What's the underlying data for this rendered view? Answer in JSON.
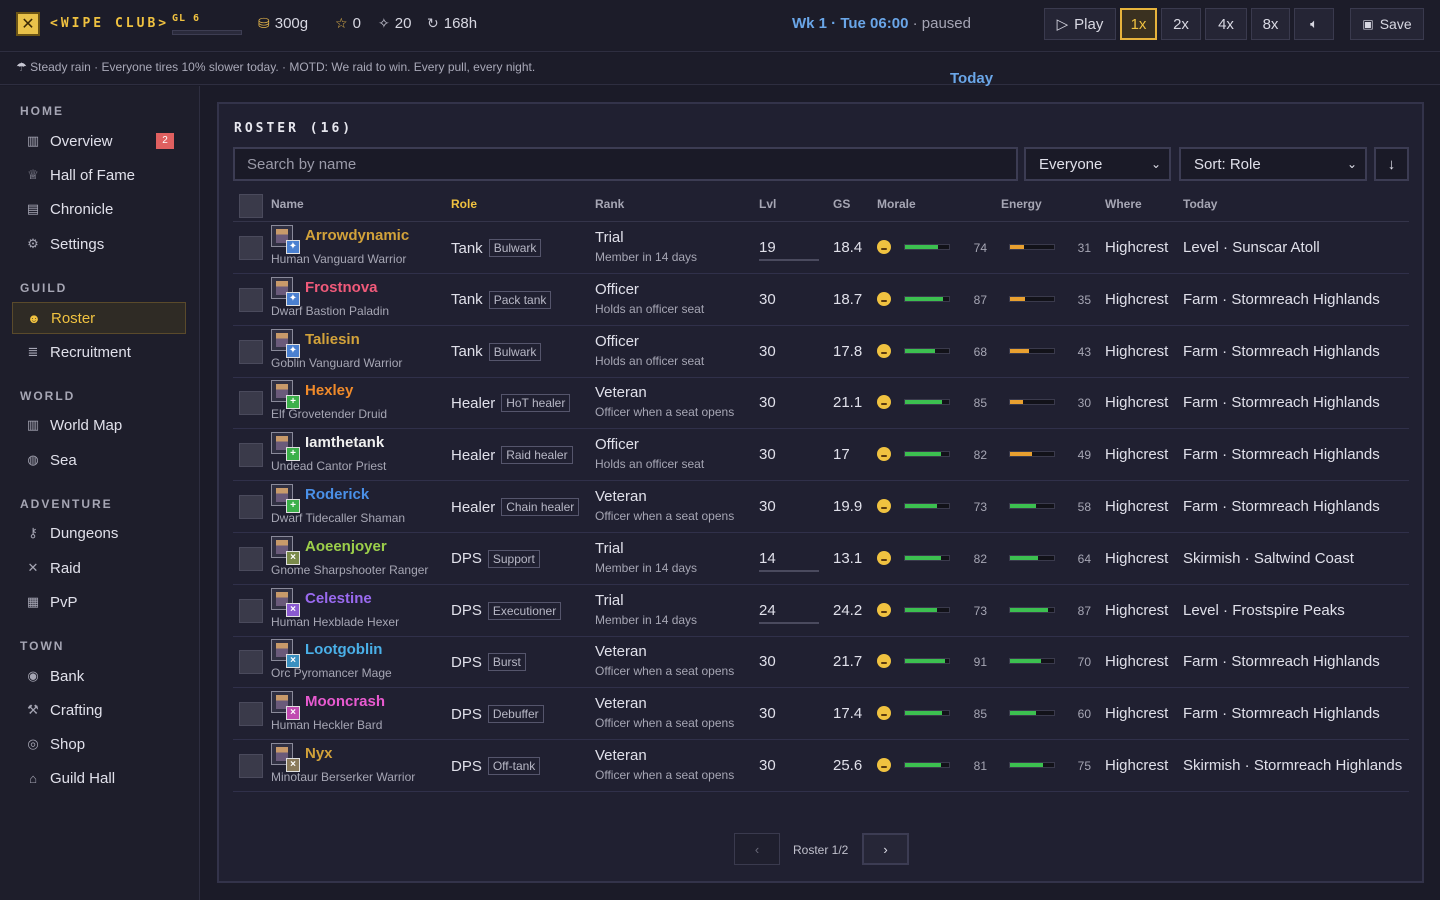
{
  "header": {
    "brand": "<WIPE CLUB>",
    "guild_level": "GL 6",
    "gold": "300g",
    "stars": "0",
    "sparks": "20",
    "hours": "168h",
    "week_day": "Wk 1 · Tue 06:00",
    "state": "· paused",
    "play_label": "Play",
    "speeds": [
      "1x",
      "2x",
      "4x",
      "8x"
    ],
    "active_speed": "1x",
    "save_label": "Save"
  },
  "motd": {
    "today_label": "Today",
    "text": "Steady rain · Everyone tires 10% slower today. · MOTD: We raid to win. Every pull, every night."
  },
  "sidebar": {
    "sections": [
      {
        "title": "HOME",
        "items": [
          {
            "label": "Overview",
            "icon": "overview-icon",
            "badge": "2"
          },
          {
            "label": "Hall of Fame",
            "icon": "trophy-icon"
          },
          {
            "label": "Chronicle",
            "icon": "book-icon"
          },
          {
            "label": "Settings",
            "icon": "gear-icon"
          }
        ]
      },
      {
        "title": "GUILD",
        "items": [
          {
            "label": "Roster",
            "icon": "people-icon",
            "active": true
          },
          {
            "label": "Recruitment",
            "icon": "scroll-icon"
          }
        ]
      },
      {
        "title": "WORLD",
        "items": [
          {
            "label": "World Map",
            "icon": "map-icon"
          },
          {
            "label": "Sea",
            "icon": "globe-icon"
          }
        ]
      },
      {
        "title": "ADVENTURE",
        "items": [
          {
            "label": "Dungeons",
            "icon": "key-icon"
          },
          {
            "label": "Raid",
            "icon": "swords-icon"
          },
          {
            "label": "PvP",
            "icon": "pvp-icon"
          }
        ]
      },
      {
        "title": "TOWN",
        "items": [
          {
            "label": "Bank",
            "icon": "bank-icon"
          },
          {
            "label": "Crafting",
            "icon": "hammer-icon"
          },
          {
            "label": "Shop",
            "icon": "bag-icon"
          },
          {
            "label": "Guild Hall",
            "icon": "house-icon"
          }
        ]
      }
    ]
  },
  "roster": {
    "title": "ROSTER (16)",
    "search_placeholder": "Search by name",
    "filter_value": "Everyone",
    "sort_value": "Sort: Role",
    "columns": [
      "Name",
      "Role",
      "Rank",
      "Lvl",
      "GS",
      "Morale",
      "Energy",
      "Where",
      "Today"
    ],
    "sorted_column": "Role",
    "rows": [
      {
        "name": "Arrowdynamic",
        "color": "#d2a23a",
        "desc": "Human Vanguard Warrior",
        "role": "Tank",
        "tag": "Bulwark",
        "rank": "Trial",
        "rank_sub": "Member in 14 days",
        "lvl": "19",
        "lvl_bar": true,
        "gs": "18.4",
        "morale": 74,
        "energy": 31,
        "where": "Highcrest",
        "today": "Level · Sunscar Atoll",
        "role_color": "#4a80d0",
        "role_glyph": "✦"
      },
      {
        "name": "Frostnova",
        "color": "#f05a7a",
        "desc": "Dwarf Bastion Paladin",
        "role": "Tank",
        "tag": "Pack tank",
        "rank": "Officer",
        "rank_sub": "Holds an officer seat",
        "lvl": "30",
        "lvl_bar": false,
        "gs": "18.7",
        "morale": 87,
        "energy": 35,
        "where": "Highcrest",
        "today": "Farm · Stormreach Highlands",
        "role_color": "#4a80d0",
        "role_glyph": "✦"
      },
      {
        "name": "Taliesin",
        "color": "#d2a23a",
        "desc": "Goblin Vanguard Warrior",
        "role": "Tank",
        "tag": "Bulwark",
        "rank": "Officer",
        "rank_sub": "Holds an officer seat",
        "lvl": "30",
        "lvl_bar": false,
        "gs": "17.8",
        "morale": 68,
        "energy": 43,
        "where": "Highcrest",
        "today": "Farm · Stormreach Highlands",
        "role_color": "#4a80d0",
        "role_glyph": "✦"
      },
      {
        "name": "Hexley",
        "color": "#f08a2a",
        "desc": "Elf Grovetender Druid",
        "role": "Healer",
        "tag": "HoT healer",
        "rank": "Veteran",
        "rank_sub": "Officer when a seat opens",
        "lvl": "30",
        "lvl_bar": false,
        "gs": "21.1",
        "morale": 85,
        "energy": 30,
        "where": "Highcrest",
        "today": "Farm · Stormreach Highlands",
        "role_color": "#3cb04a",
        "role_glyph": "+"
      },
      {
        "name": "Iamthetank",
        "color": "#f0f0f0",
        "desc": "Undead Cantor Priest",
        "role": "Healer",
        "tag": "Raid healer",
        "rank": "Officer",
        "rank_sub": "Holds an officer seat",
        "lvl": "30",
        "lvl_bar": false,
        "gs": "17",
        "morale": 82,
        "energy": 49,
        "where": "Highcrest",
        "today": "Farm · Stormreach Highlands",
        "role_color": "#3cb04a",
        "role_glyph": "+"
      },
      {
        "name": "Roderick",
        "color": "#4a90e8",
        "desc": "Dwarf Tidecaller Shaman",
        "role": "Healer",
        "tag": "Chain healer",
        "rank": "Veteran",
        "rank_sub": "Officer when a seat opens",
        "lvl": "30",
        "lvl_bar": false,
        "gs": "19.9",
        "morale": 73,
        "energy": 58,
        "where": "Highcrest",
        "today": "Farm · Stormreach Highlands",
        "role_color": "#3cb04a",
        "role_glyph": "+"
      },
      {
        "name": "Aoeenjoyer",
        "color": "#9ccf4a",
        "desc": "Gnome Sharpshooter Ranger",
        "role": "DPS",
        "tag": "Support",
        "rank": "Trial",
        "rank_sub": "Member in 14 days",
        "lvl": "14",
        "lvl_bar": true,
        "gs": "13.1",
        "morale": 82,
        "energy": 64,
        "where": "Highcrest",
        "today": "Skirmish · Saltwind Coast",
        "role_color": "#7a8a4a",
        "role_glyph": "×"
      },
      {
        "name": "Celestine",
        "color": "#9a6af0",
        "desc": "Human Hexblade Hexer",
        "role": "DPS",
        "tag": "Executioner",
        "rank": "Trial",
        "rank_sub": "Member in 14 days",
        "lvl": "24",
        "lvl_bar": true,
        "gs": "24.2",
        "morale": 73,
        "energy": 87,
        "where": "Highcrest",
        "today": "Level · Frostspire Peaks",
        "role_color": "#8a5ad0",
        "role_glyph": "×"
      },
      {
        "name": "Lootgoblin",
        "color": "#4ab0e8",
        "desc": "Orc Pyromancer Mage",
        "role": "DPS",
        "tag": "Burst",
        "rank": "Veteran",
        "rank_sub": "Officer when a seat opens",
        "lvl": "30",
        "lvl_bar": false,
        "gs": "21.7",
        "morale": 91,
        "energy": 70,
        "where": "Highcrest",
        "today": "Farm · Stormreach Highlands",
        "role_color": "#3a90c0",
        "role_glyph": "×"
      },
      {
        "name": "Mooncrash",
        "color": "#e85ad0",
        "desc": "Human Heckler Bard",
        "role": "DPS",
        "tag": "Debuffer",
        "rank": "Veteran",
        "rank_sub": "Officer when a seat opens",
        "lvl": "30",
        "lvl_bar": false,
        "gs": "17.4",
        "morale": 85,
        "energy": 60,
        "where": "Highcrest",
        "today": "Farm · Stormreach Highlands",
        "role_color": "#c04ab0",
        "role_glyph": "×"
      },
      {
        "name": "Nyx",
        "color": "#d2a23a",
        "desc": "Minotaur Berserker Warrior",
        "role": "DPS",
        "tag": "Off-tank",
        "rank": "Veteran",
        "rank_sub": "Officer when a seat opens",
        "lvl": "30",
        "lvl_bar": false,
        "gs": "25.6",
        "morale": 81,
        "energy": 75,
        "where": "Highcrest",
        "today": "Skirmish · Stormreach Highlands",
        "role_color": "#8a7a5a",
        "role_glyph": "×"
      }
    ],
    "pager_label": "Roster 1/2"
  }
}
